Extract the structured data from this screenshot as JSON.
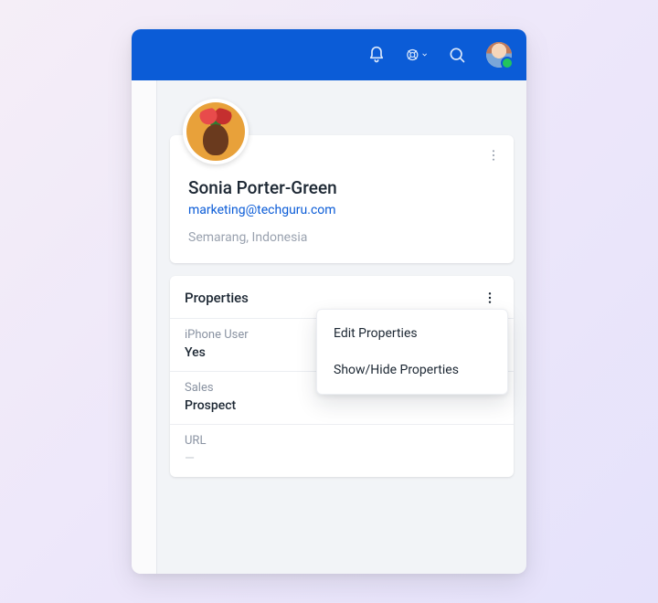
{
  "header": {
    "icons": {
      "bell": "notifications-icon",
      "help": "help-icon",
      "search": "search-icon",
      "user": "current-user-avatar"
    }
  },
  "profile": {
    "name": "Sonia Porter-Green",
    "email": "marketing@techguru.com",
    "location": "Semarang, Indonesia"
  },
  "properties": {
    "title": "Properties",
    "items": [
      {
        "label": "iPhone User",
        "value": "Yes"
      },
      {
        "label": "Sales",
        "value": "Prospect"
      },
      {
        "label": "URL",
        "value": "—",
        "empty": true
      }
    ],
    "menu": {
      "edit": "Edit Properties",
      "showhide": "Show/Hide Properties"
    }
  }
}
